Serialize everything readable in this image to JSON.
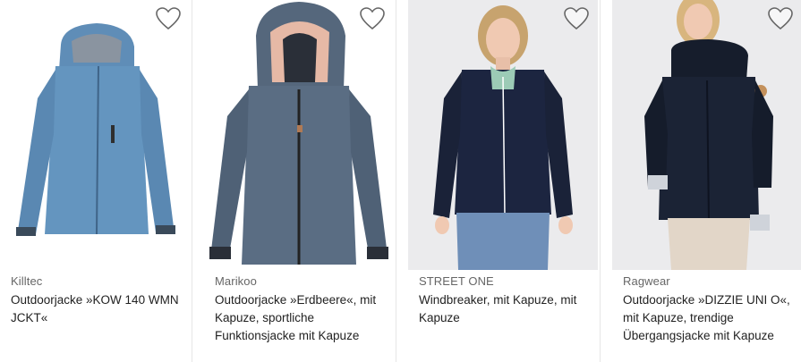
{
  "products": [
    {
      "brand": "Killtec",
      "title": "Outdoorjacke »KOW 140 WMN JCKT«",
      "wishlist_icon": "heart-outline-icon",
      "jacket_color": "#5f8db7"
    },
    {
      "brand": "Marikoo",
      "title": "Outdoorjacke »Erdbeere«, mit Kapuze, sportliche Funktionsjacke mit Kapuze",
      "wishlist_icon": "heart-outline-icon",
      "jacket_color": "#55677c"
    },
    {
      "brand": "STREET ONE",
      "title": "Windbreaker, mit Kapuze, mit Kapuze",
      "wishlist_icon": "heart-outline-icon",
      "jacket_color": "#1c2540"
    },
    {
      "brand": "Ragwear",
      "title": "Outdoorjacke »DIZZIE UNI O«, mit Kapuze, trendige Übergangsjacke mit Kapuze",
      "wishlist_icon": "heart-outline-icon",
      "jacket_color": "#161d2c"
    }
  ]
}
